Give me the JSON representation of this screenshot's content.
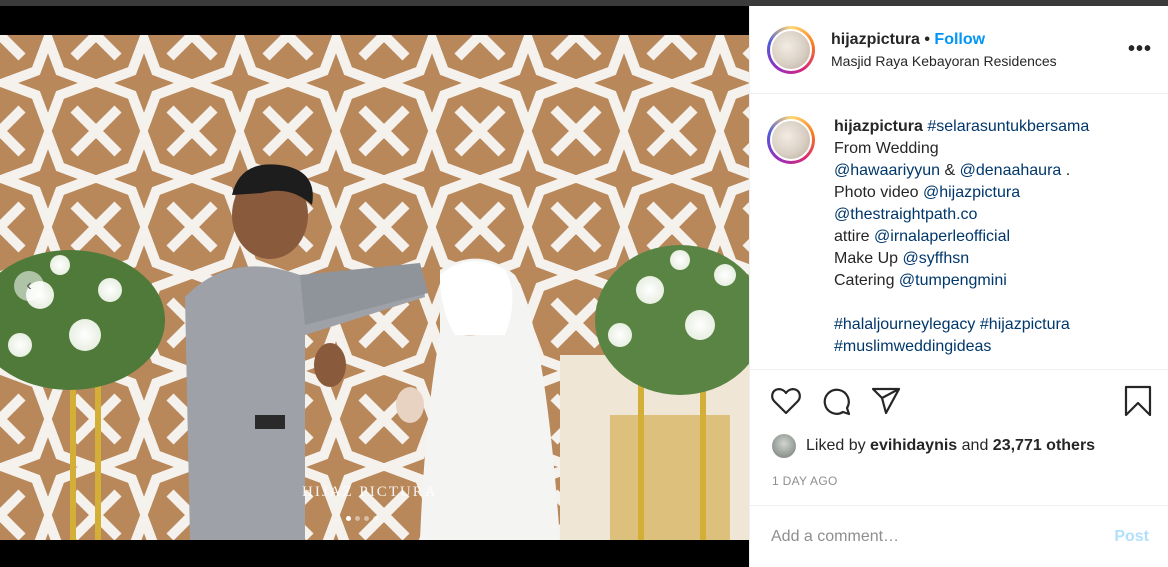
{
  "post": {
    "username": "hijazpictura",
    "separator": "•",
    "follow_label": "Follow",
    "location": "Masjid Raya Kebayoran Residences",
    "more_icon": "more-options-icon",
    "more_glyph": "•••"
  },
  "media": {
    "watermark": "HIJAZ PICTURA",
    "prev_glyph": "‹",
    "carousel_count": 4,
    "carousel_active": 1
  },
  "caption": {
    "username": "hijazpictura",
    "first_tag": "#selarasuntukbersama",
    "lines": [
      {
        "text": "From Wedding",
        "mentions": []
      },
      {
        "parts": [
          {
            "t": "@hawaariyyun",
            "tag": true
          },
          {
            "t": " & ",
            "tag": false
          },
          {
            "t": "@denaahaura",
            "tag": true
          },
          {
            "t": " .",
            "tag": false
          }
        ]
      },
      {
        "parts": [
          {
            "t": "Photo video ",
            "tag": false
          },
          {
            "t": "@hijazpictura",
            "tag": true
          }
        ]
      },
      {
        "parts": [
          {
            "t": "@thestraightpath.co",
            "tag": true
          }
        ]
      },
      {
        "parts": [
          {
            "t": "attire ",
            "tag": false
          },
          {
            "t": "@irnalaperleofficial",
            "tag": true
          }
        ]
      },
      {
        "parts": [
          {
            "t": "Make Up ",
            "tag": false
          },
          {
            "t": "@syffhsn",
            "tag": true
          }
        ]
      },
      {
        "parts": [
          {
            "t": "Catering ",
            "tag": false
          },
          {
            "t": "@tumpengmini",
            "tag": true
          }
        ]
      },
      {
        "parts": [
          {
            "t": "#halaljourneylegacy",
            "tag": true
          },
          {
            "t": " ",
            "tag": false
          },
          {
            "t": "#hijazpictura",
            "tag": true
          }
        ]
      },
      {
        "parts": [
          {
            "t": "#muslimweddingideas",
            "tag": true
          }
        ]
      }
    ]
  },
  "actions": {
    "like_icon": "heart-icon",
    "comment_icon": "comment-icon",
    "share_icon": "share-icon",
    "save_icon": "bookmark-icon"
  },
  "likes": {
    "prefix": "Liked by ",
    "user": "evihidaynis",
    "middle": " and ",
    "others": "23,771 others"
  },
  "timestamp": "1 DAY AGO",
  "comment": {
    "placeholder": "Add a comment…",
    "post_label": "Post"
  },
  "colors": {
    "link": "#0095f6",
    "tag": "#00376b",
    "post_disabled": "#b2dffc",
    "text": "#262626",
    "muted": "#8e8e8e"
  }
}
